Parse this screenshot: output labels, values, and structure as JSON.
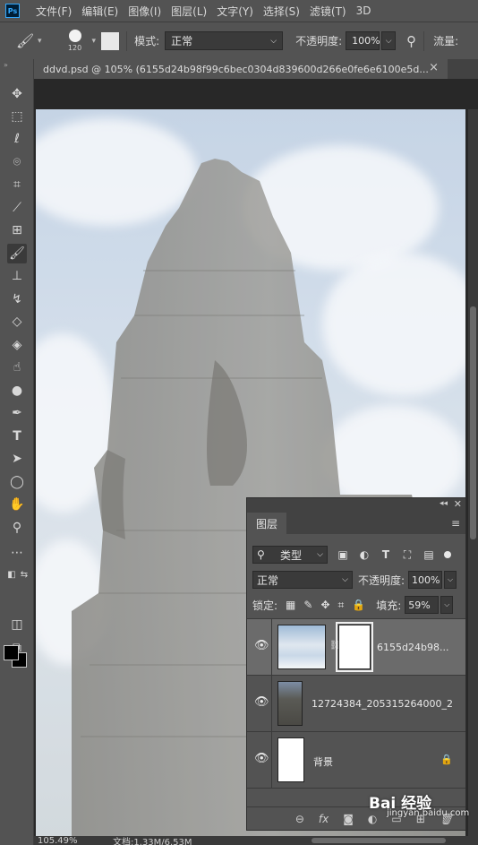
{
  "menubar": {
    "logo": "Ps",
    "items": [
      "文件(F)",
      "编辑(E)",
      "图像(I)",
      "图层(L)",
      "文字(Y)",
      "选择(S)",
      "滤镜(T)",
      "3D"
    ]
  },
  "options": {
    "brush_size": "120",
    "mode_label": "模式:",
    "mode_value": "正常",
    "opacity_label": "不透明度:",
    "opacity_value": "100%",
    "flow_label": "流量:"
  },
  "tab": {
    "title": "ddvd.psd @ 105% (6155d24b98f99c6bec0304d839600d266e0fe6e6100e5d...",
    "close": "×"
  },
  "toolbar": {
    "tools": [
      "move-tool",
      "marquee-tool",
      "lasso-tool",
      "quick-select-tool",
      "crop-tool",
      "eyedropper-tool",
      "healing-tool",
      "brush-tool",
      "stamp-tool",
      "history-brush-tool",
      "eraser-tool",
      "paint-bucket-tool",
      "smudge-tool",
      "dodge-tool",
      "pen-tool",
      "type-tool",
      "path-select-tool",
      "ellipse-tool",
      "hand-tool",
      "zoom-tool",
      "more-tools"
    ],
    "foreground_color": "#000000",
    "background_color": "#000000"
  },
  "status": {
    "zoom": "105.49%",
    "doc": "文档:1.33M/6.53M"
  },
  "layers_panel": {
    "tab_label": "图层",
    "filter_value": "类型",
    "blend_value": "正常",
    "opacity_label": "不透明度:",
    "opacity_value": "100%",
    "lock_label": "锁定:",
    "fill_label": "填充:",
    "fill_value": "59%",
    "layers": [
      {
        "name": "6155d24b98...",
        "selected": true,
        "has_mask": true
      },
      {
        "name": "12724384_205315264000_2",
        "selected": false
      },
      {
        "name": "背景",
        "selected": false,
        "locked": true
      }
    ],
    "footer_fx": "fx"
  },
  "watermark": {
    "brand": "Bai 经验",
    "url": "jingyan.baidu.com"
  }
}
